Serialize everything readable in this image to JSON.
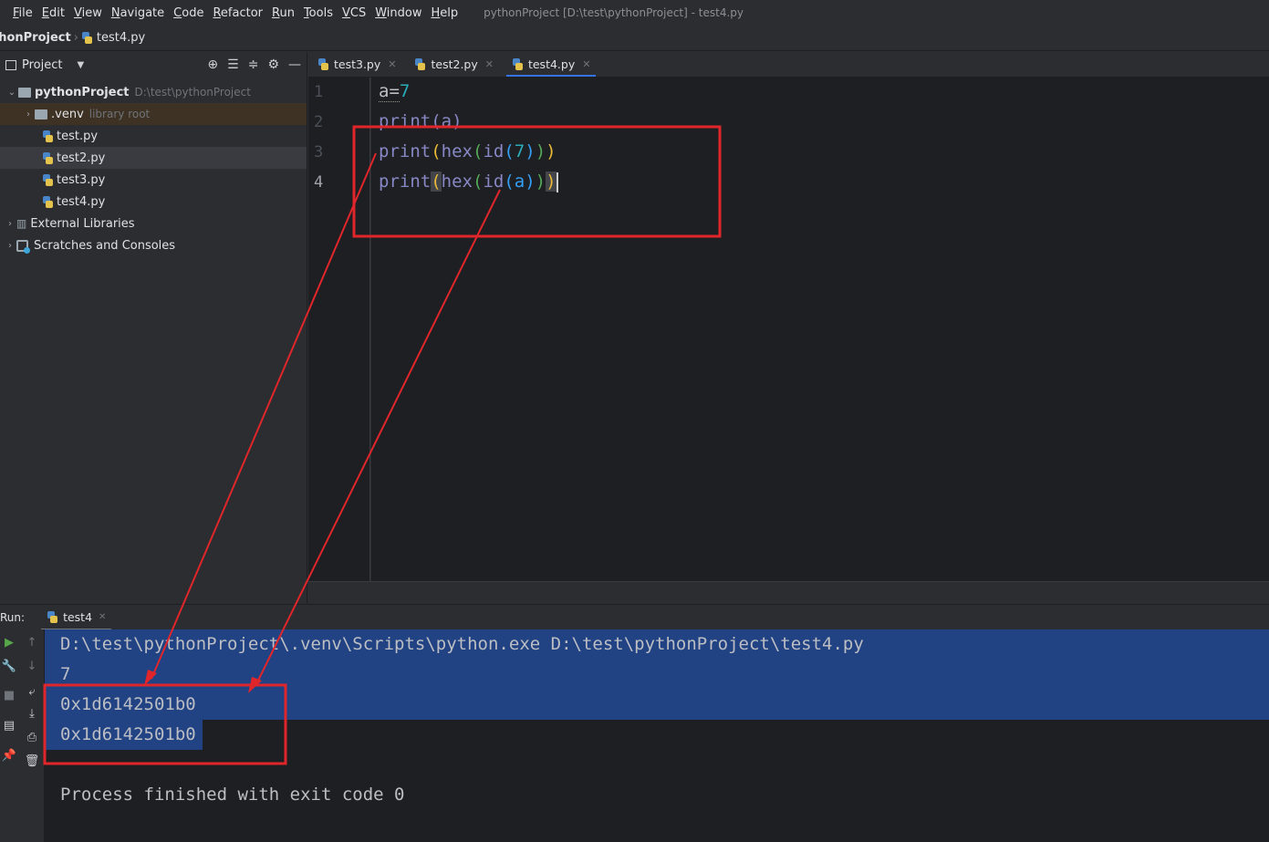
{
  "menu": {
    "items": [
      "File",
      "Edit",
      "View",
      "Navigate",
      "Code",
      "Refactor",
      "Run",
      "Tools",
      "VCS",
      "Window",
      "Help"
    ],
    "window_title": "pythonProject [D:\\test\\pythonProject] - test4.py"
  },
  "breadcrumb": {
    "project": "thonProject",
    "file": "test4.py"
  },
  "project_panel": {
    "title": "Project",
    "root_name": "pythonProject",
    "root_path": "D:\\test\\pythonProject",
    "venv_name": ".venv",
    "venv_hint": "library root",
    "files": [
      "test.py",
      "test2.py",
      "test3.py",
      "test4.py"
    ],
    "external_libraries": "External Libraries",
    "scratches": "Scratches and Consoles"
  },
  "editor_tabs": [
    {
      "label": "test3.py"
    },
    {
      "label": "test2.py"
    },
    {
      "label": "test4.py",
      "active": true
    }
  ],
  "editor": {
    "line_numbers": [
      "1",
      "2",
      "3",
      "4"
    ],
    "lines": [
      {
        "a": "a=",
        "b": "7"
      },
      {
        "a": "print(a)"
      },
      {
        "a": "print",
        "b": "(",
        "c": "hex",
        "d": "(",
        "e": "id",
        "f": "(",
        "g": "7",
        "h": ")",
        "i": ")",
        "j": ")"
      },
      {
        "a": "print",
        "b": "(",
        "c": "hex",
        "d": "(",
        "e": "id",
        "f": "(a",
        "g": ")",
        "h": ")",
        "i": ")"
      }
    ]
  },
  "run_panel": {
    "label": "Run:",
    "tab": "test4",
    "console_lines": [
      "D:\\test\\pythonProject\\.venv\\Scripts\\python.exe D:\\test\\pythonProject\\test4.py",
      "7",
      "0x1d6142501b0",
      "0x1d6142501b0",
      "",
      "Process finished with exit code 0"
    ]
  },
  "colors": {
    "annotation": "#e0262b",
    "selection": "#214283",
    "accent": "#3574f0"
  }
}
